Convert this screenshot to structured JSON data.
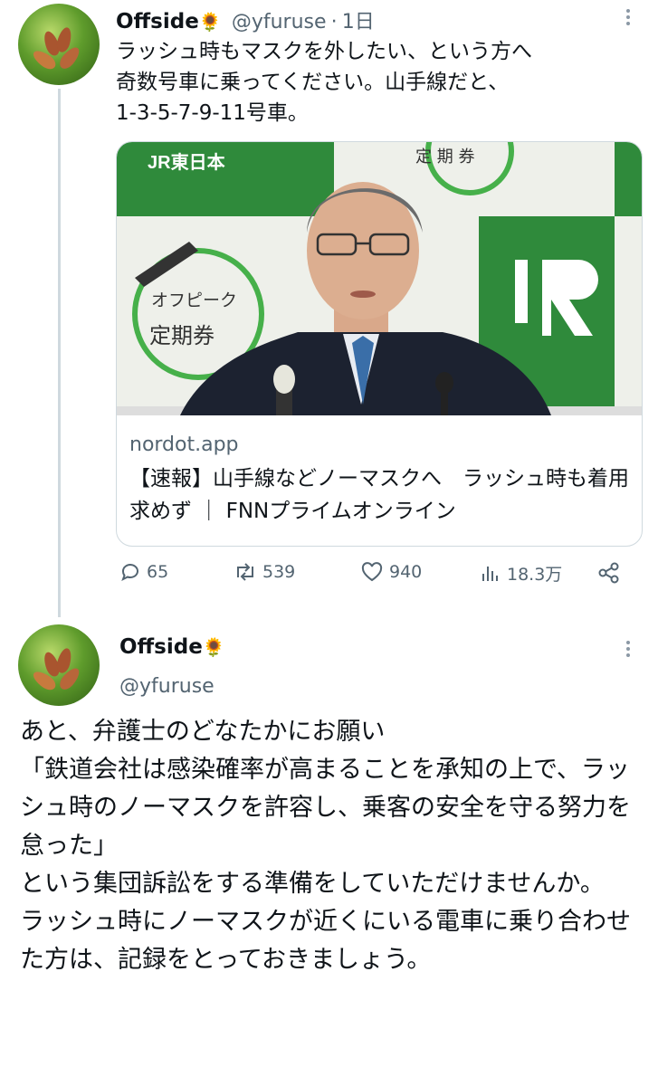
{
  "tweet1": {
    "display_name": "Offside",
    "name_emoji": "🌻",
    "handle": "@yfuruse",
    "separator": "·",
    "time": "1日",
    "text": "ラッシュ時もマスクを外したい、という方へ\n奇数号車に乗ってください。山手線だと、\n1-3-5-7-9-11号車。",
    "card": {
      "image_brand": "JR東日本",
      "image_banner_top": "定 期 券",
      "image_banner_line1": "オフピーク",
      "image_banner_line2": "定期券",
      "image_logo": "JR",
      "domain": "nordot.app",
      "title": "【速報】山手線などノーマスクへ　ラッシュ時も着用求めず ｜ FNNプライムオンライン"
    },
    "stats": {
      "replies": "65",
      "retweets": "539",
      "likes": "940",
      "views": "18.3万"
    }
  },
  "tweet2": {
    "display_name": "Offside",
    "name_emoji": "🌻",
    "handle": "@yfuruse",
    "text": "あと、弁護士のどなたかにお願い\n「鉄道会社は感染確率が高まることを承知の上で、ラッシュ時のノーマスクを許容し、乗客の安全を守る努力を怠った」\nという集団訴訟をする準備をしていただけませんか。\nラッシュ時にノーマスクが近くにいる電車に乗り合わせた方は、記録をとっておきましょう。"
  },
  "colors": {
    "text": "#0f1419",
    "secondary": "#536471",
    "border": "#cfd9de",
    "jr_green": "#2e8b3a"
  },
  "icons": [
    "reply-icon",
    "retweet-icon",
    "like-icon",
    "views-icon",
    "share-icon",
    "more-icon"
  ]
}
